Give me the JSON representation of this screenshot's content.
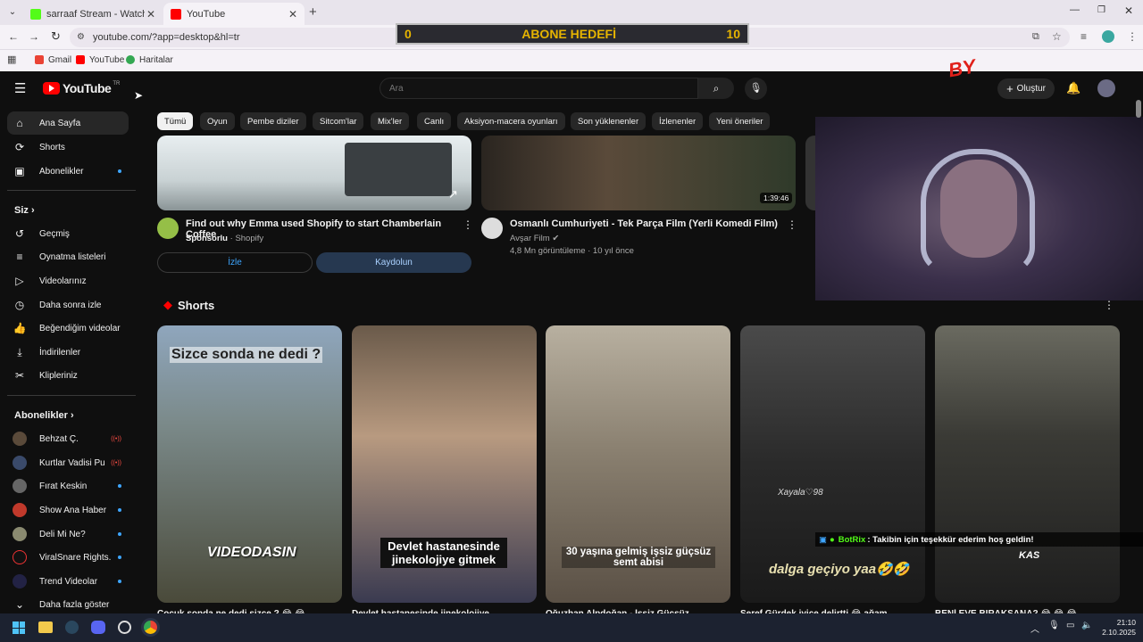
{
  "browser": {
    "tabs": [
      {
        "label": "sarraaf Stream - Watch Live on",
        "color": "#53fc18"
      },
      {
        "label": "YouTube",
        "color": "#ff0000"
      }
    ],
    "new_tab": "+",
    "url": "youtube.com/?app=desktop&hl=tr",
    "bookmarks": [
      "Gmail",
      "YouTube",
      "Haritalar"
    ]
  },
  "overlay": {
    "abone_left": "0",
    "abone_title": "ABONE HEDEFİ",
    "abone_right": "10",
    "chat_user": "BotRix",
    "chat_text": ": Takibin için teşekkür ederim hoş geldin!"
  },
  "youtube": {
    "logo": "YouTube",
    "region": "TR",
    "search_placeholder": "Ara",
    "create_label": "Oluştur",
    "nav": [
      {
        "label": "Ana Sayfa",
        "icon": "home-icon"
      },
      {
        "label": "Shorts",
        "icon": "shorts-icon"
      },
      {
        "label": "Abonelikler",
        "icon": "subscriptions-icon"
      }
    ],
    "you_header": "Siz",
    "you_items": [
      "Geçmiş",
      "Oynatma listeleri",
      "Videolarınız",
      "Daha sonra izle",
      "Beğendiğim videolar",
      "İndirilenler",
      "Klipleriniz"
    ],
    "subs_header": "Abonelikler",
    "subs": [
      {
        "label": "Behzat Ç.",
        "live": true
      },
      {
        "label": "Kurtlar Vadisi Pu...",
        "live": true
      },
      {
        "label": "Fırat Keskin",
        "live": false
      },
      {
        "label": "Show Ana Haber",
        "live": false
      },
      {
        "label": "Deli Mi Ne?",
        "live": false
      },
      {
        "label": "ViralSnare Rights...",
        "live": false
      },
      {
        "label": "Trend Videolar",
        "live": false
      }
    ],
    "show_more": "Daha fazla göster",
    "chips": [
      "Tümü",
      "Oyun",
      "Pembe diziler",
      "Sitcom'lar",
      "Mix'ler",
      "Canlı",
      "Aksiyon-macera oyunları",
      "Son yüklenenler",
      "İzlenenler",
      "Yeni öneriler"
    ],
    "ad": {
      "title": "Find out why Emma used Shopify to start Chamberlain Coffee",
      "sponsor_label": "Sponsorlu",
      "sponsor": "Shopify",
      "watch_button": "İzle",
      "subscribe_button": "Kaydolun"
    },
    "video": {
      "title": "Osmanlı Cumhuriyeti - Tek Parça Film (Yerli Komedi Film)",
      "channel": "Avşar Film",
      "meta": "4,8 Mn görüntüleme · 10 yıl önce",
      "duration": "1:39:46"
    },
    "shorts_header": "Shorts",
    "shorts": [
      {
        "overlay": "Sizce sonda ne dedi ?",
        "bottom": "VIDEODASIN",
        "caption": "Çocuk sonda ne dedi sizce ? 😂 😂"
      },
      {
        "overlay": "Devlet hastanesinde jinekolojiye gitmek",
        "bottom": "",
        "caption": "Devlet hastanesinde jinekolojiye..."
      },
      {
        "overlay": "30 yaşına gelmiş işsiz güçsüz semt abisi",
        "bottom": "",
        "caption": "Oğuzhan Alpdoğan - İşsiz Güçsüz..."
      },
      {
        "overlay": "dalga geçiyo yaa🤣🤣",
        "bottom": "Xayala♡98",
        "caption": "Şeref Gürdek iyice delirtti 😂 ağam..."
      },
      {
        "overlay": "KAS",
        "bottom": "",
        "caption": "BENİ EVE BIRAKSANA? 😂 😂 😂"
      }
    ]
  },
  "taskbar": {
    "time": "21:10",
    "date": "2.10.2025"
  }
}
